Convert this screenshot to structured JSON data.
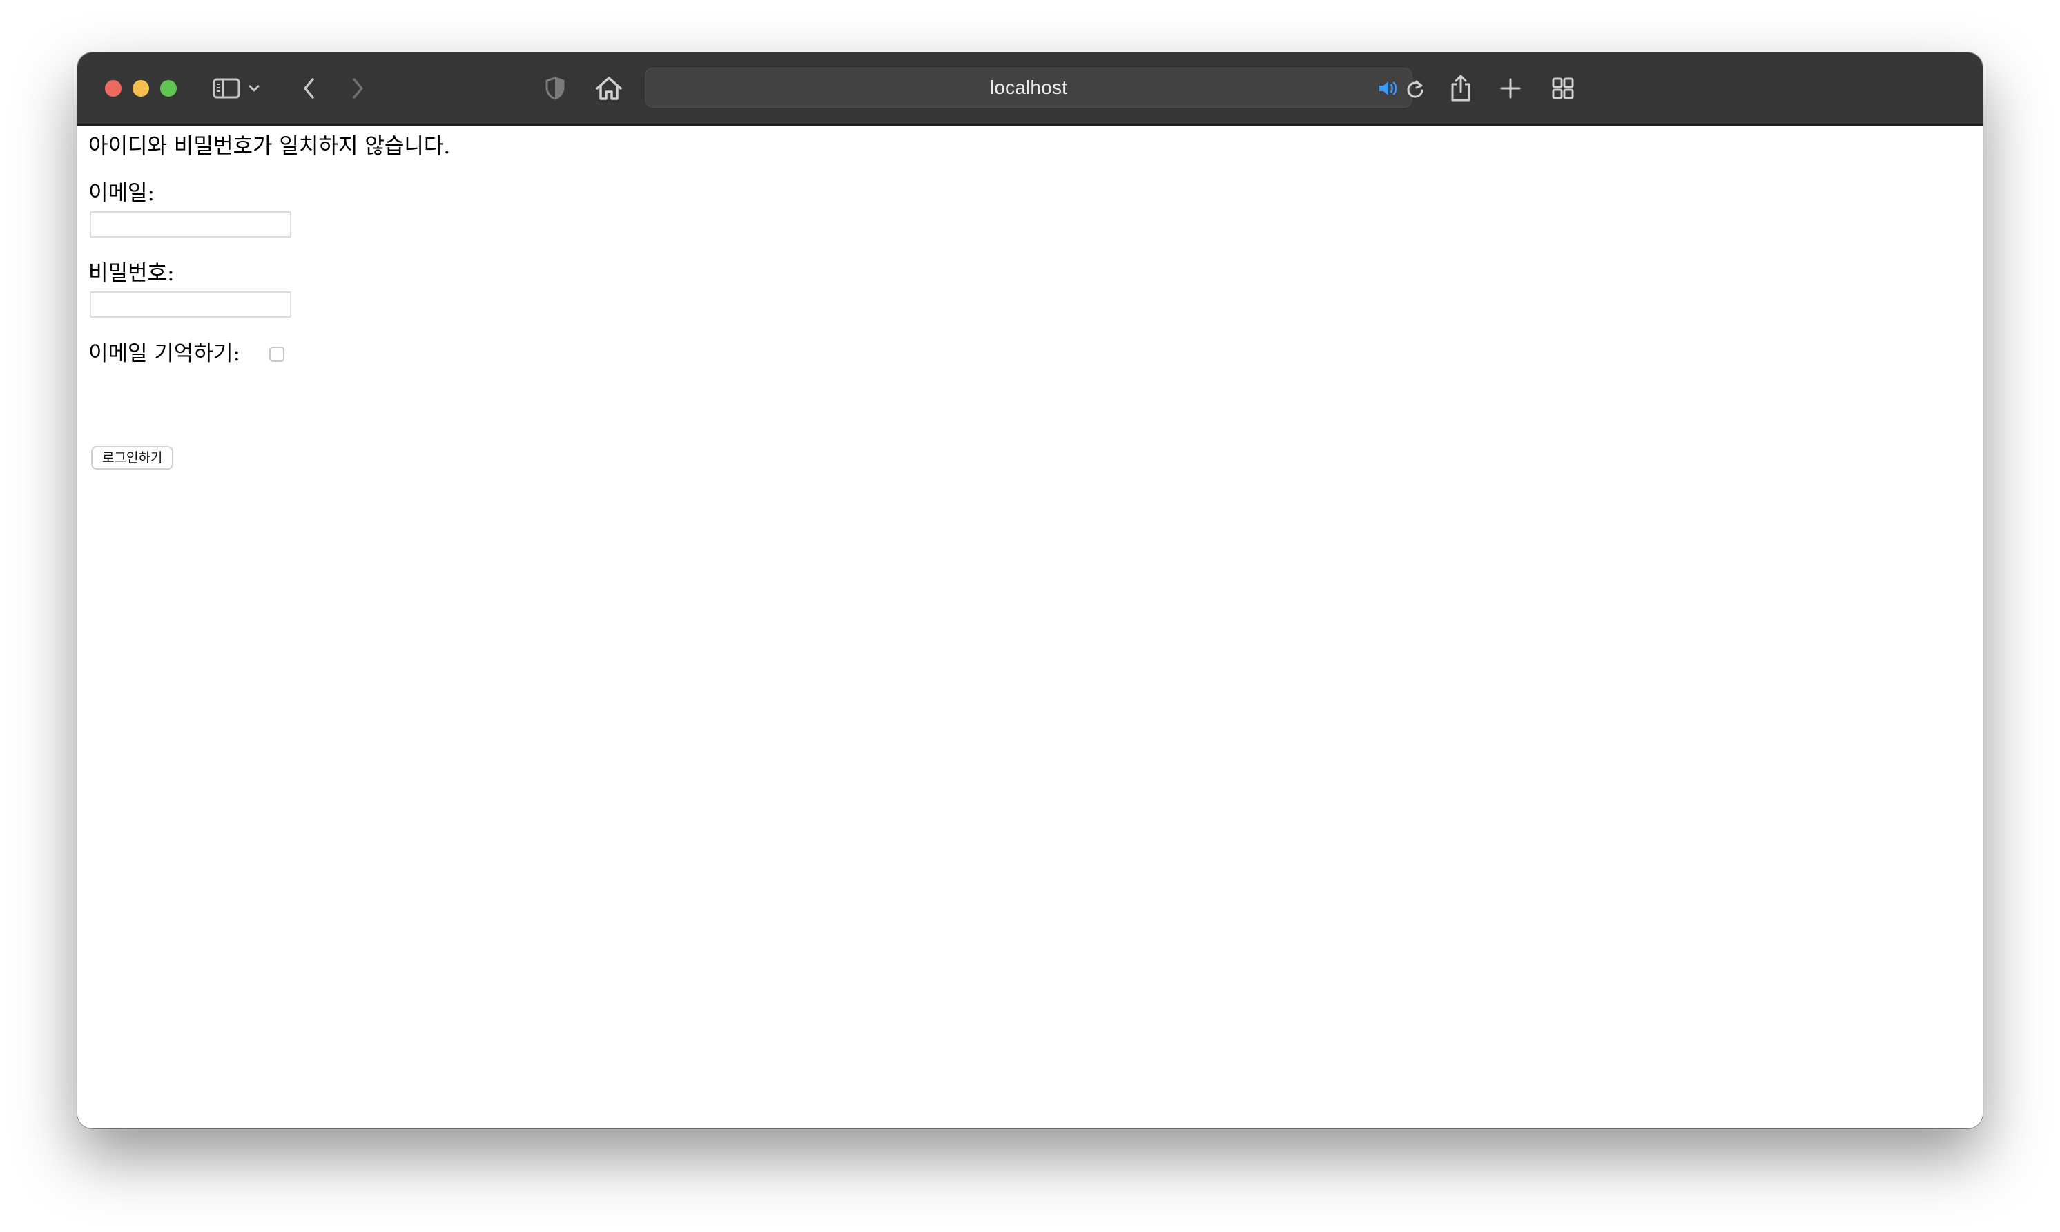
{
  "browser": {
    "address_text": "localhost",
    "accent_color": "#3b9cff",
    "traffic_lights": [
      "#ed6a5e",
      "#f5bf4f",
      "#61c554"
    ],
    "toolbar_icons": [
      "sidebar-toggle-icon",
      "chevron-down-icon",
      "back-icon",
      "forward-icon",
      "privacy-shield-icon",
      "home-icon",
      "audio-playing-icon",
      "reload-icon",
      "share-icon",
      "new-tab-icon",
      "tab-overview-icon"
    ]
  },
  "page": {
    "error_message": "아이디와 비밀번호가 일치하지 않습니다.",
    "email_label": "이메일:",
    "email_value": "",
    "password_label": "비밀번호:",
    "password_value": "",
    "remember_label": "이메일 기억하기:",
    "remember_checked": false,
    "submit_label": "로그인하기"
  }
}
